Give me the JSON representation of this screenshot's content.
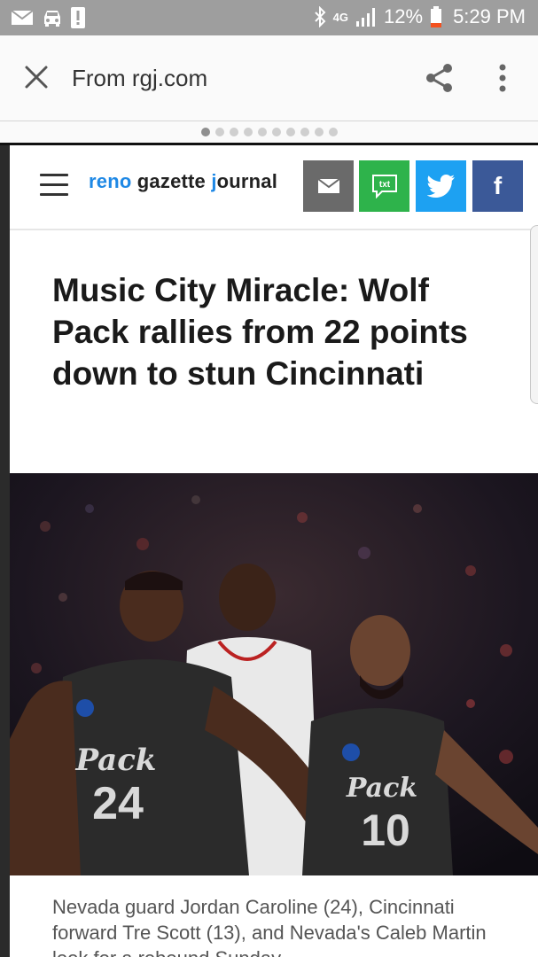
{
  "status_bar": {
    "network": "4G",
    "battery": "12%",
    "time": "5:29 PM"
  },
  "toolbar": {
    "url": "From rgj.com"
  },
  "pager": {
    "count": 10,
    "active": 0
  },
  "site": {
    "brand_reno": "reno",
    "brand_rest": " gazette ",
    "brand_j": "j",
    "brand_ournal": "ournal",
    "share_buttons": [
      "mail-icon",
      "txt-icon",
      "twitter-icon",
      "facebook-icon"
    ],
    "txt_label": "txt",
    "facebook_label": "f"
  },
  "article": {
    "headline": "Music City Miracle: Wolf Pack rallies from 22 points down to stun Cincinnati",
    "jerseys": [
      {
        "team": "Pack",
        "number": "24"
      },
      {
        "team": "Pack",
        "number": "10"
      }
    ],
    "caption": "Nevada guard Jordan Caroline (24), Cincinnati forward Tre Scott (13), and Nevada's Caleb Martin look for a rebound Sunday"
  },
  "colors": {
    "status_bar": "#9e9e9e",
    "brand_blue": "#1e88e5",
    "mail_gray": "#6a6a6a",
    "txt_green": "#2eb34b",
    "twitter_blue": "#1da1f2",
    "facebook_blue": "#3b5998"
  }
}
